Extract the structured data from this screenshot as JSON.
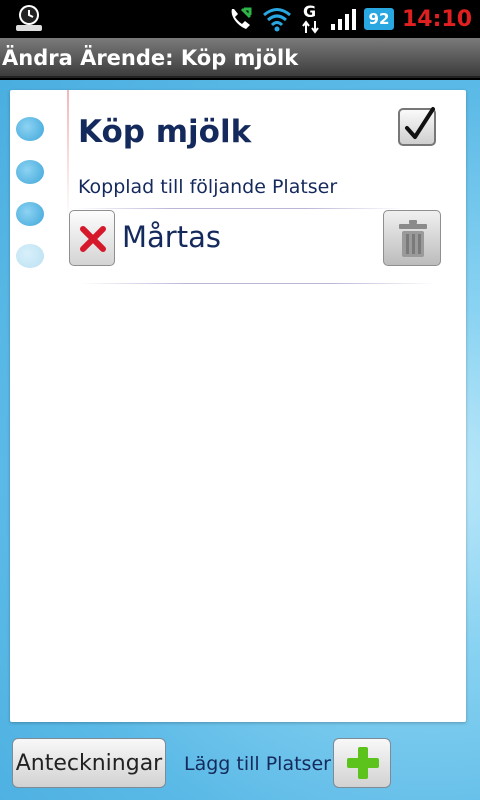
{
  "status_bar": {
    "clock": "14:10",
    "battery_level": "92",
    "network_type": "G",
    "icons": [
      "alarm-app-icon",
      "call-forward-icon",
      "wifi-icon",
      "data-transfer-icon",
      "signal-icon",
      "battery-icon"
    ]
  },
  "title_bar": {
    "title": "Ändra Ärende: Köp mjölk"
  },
  "task": {
    "title": "Köp mjölk",
    "done": true,
    "linked_label": "Kopplad till följande Platser",
    "places": [
      {
        "name": "Mårtas"
      }
    ]
  },
  "bottom_bar": {
    "notes_label": "Anteckningar",
    "add_places_label": "Lägg till Platser"
  },
  "colors": {
    "text_navy": "#152a5c",
    "clock_red": "#e02020",
    "background_blue": "#5ab9e6",
    "add_green": "#5cc21c",
    "remove_red": "#d6182b"
  }
}
